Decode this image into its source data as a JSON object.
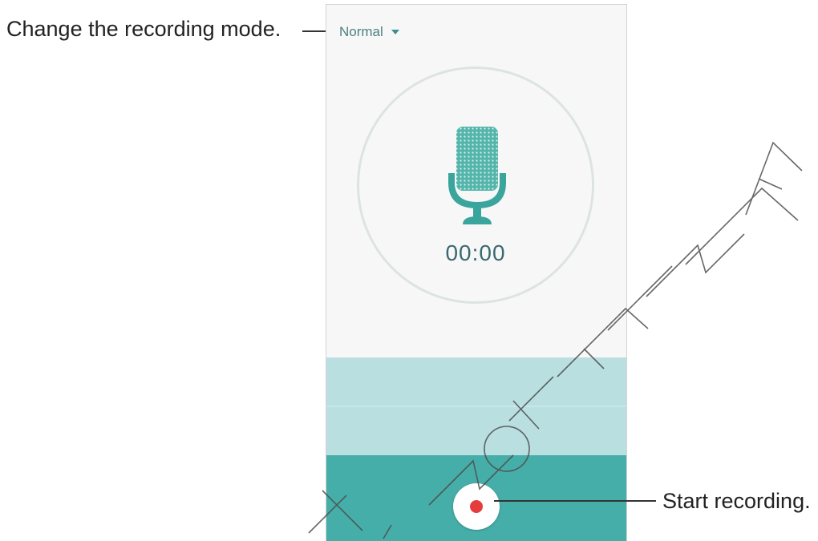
{
  "callouts": {
    "mode": "Change the recording mode.",
    "record": "Start recording."
  },
  "recorder": {
    "mode": "Normal",
    "timer": "00:00",
    "icons": {
      "mode_dropdown": "chevron-down-icon",
      "microphone": "microphone-icon",
      "record": "record-icon"
    }
  },
  "watermark": "DRAFT, Not FINAL",
  "colors": {
    "accent": "#46aea9",
    "wave_area": "#b9dfe0",
    "record_dot": "#e53d3d",
    "text_teal": "#3a6a6e"
  }
}
